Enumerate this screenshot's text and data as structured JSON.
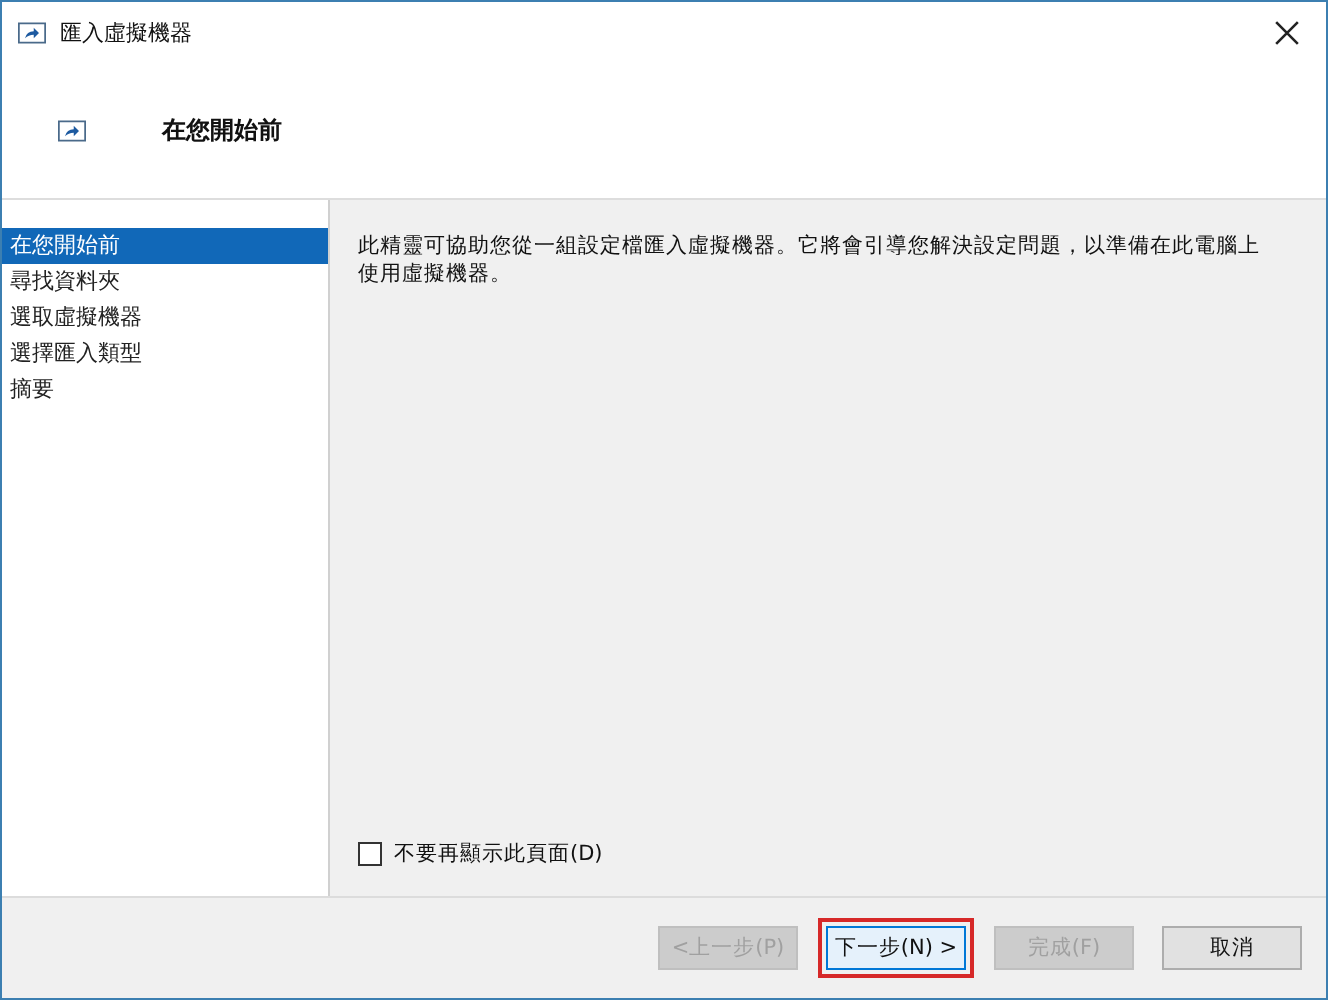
{
  "window": {
    "title": "匯入虛擬機器"
  },
  "header": {
    "title": "在您開始前"
  },
  "steps": [
    {
      "label": "在您開始前",
      "selected": true
    },
    {
      "label": "尋找資料夾",
      "selected": false
    },
    {
      "label": "選取虛擬機器",
      "selected": false
    },
    {
      "label": "選擇匯入類型",
      "selected": false
    },
    {
      "label": "摘要",
      "selected": false
    }
  ],
  "description": "此精靈可協助您從一組設定檔匯入虛擬機器。它將會引導您解決設定問題，以準備在此電腦上使用虛擬機器。",
  "dont_show_again": {
    "label": "不要再顯示此頁面(D)",
    "checked": false
  },
  "buttons": [
    {
      "label": "<上一步(P)",
      "disabled": true,
      "highlighted": false
    },
    {
      "label": "下一步(N) >",
      "disabled": false,
      "highlighted": true
    },
    {
      "label": "完成(F)",
      "disabled": true,
      "highlighted": false
    },
    {
      "label": "取消",
      "disabled": false,
      "highlighted": false
    }
  ]
}
